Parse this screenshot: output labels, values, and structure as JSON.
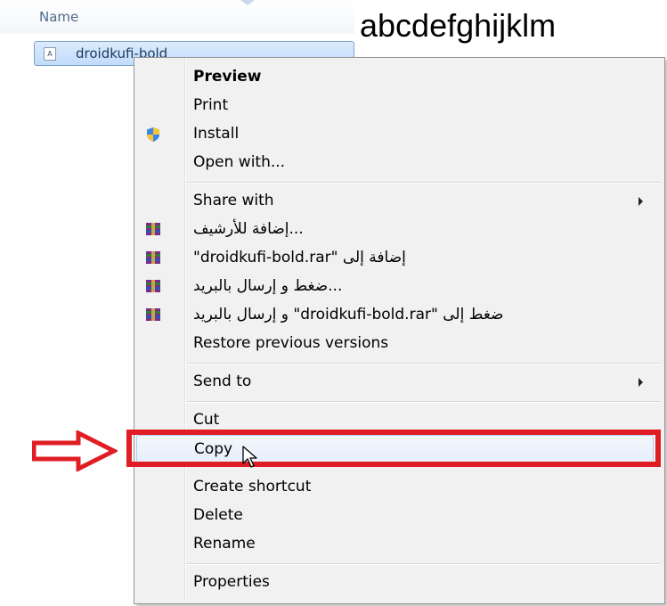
{
  "explorer": {
    "column_header": "Name",
    "file_name": "droidkufi-bold",
    "file_icon_letter": "A"
  },
  "preview": {
    "sample_text": "abcdefghijklm"
  },
  "menu": {
    "items": {
      "preview": "Preview",
      "print": "Print",
      "install": "Install",
      "open_with": "Open with...",
      "share_with": "Share with",
      "rar_add_archive": "...إضافة للأرشيف",
      "rar_add_to": "إضافة إلى \"droidkufi-bold.rar\"",
      "rar_compress_email": "...ضغط و إرسال بالبريد",
      "rar_compress_to_email": "ضغط إلى \"droidkufi-bold.rar\" و إرسال بالبريد",
      "restore": "Restore previous versions",
      "send_to": "Send to",
      "cut": "Cut",
      "copy": "Copy",
      "create_shortcut": "Create shortcut",
      "delete": "Delete",
      "rename": "Rename",
      "properties": "Properties"
    }
  },
  "colors": {
    "annotation_red": "#e01d24",
    "selection_border": "#7da2ce",
    "menu_bg": "#f1f1f1"
  }
}
